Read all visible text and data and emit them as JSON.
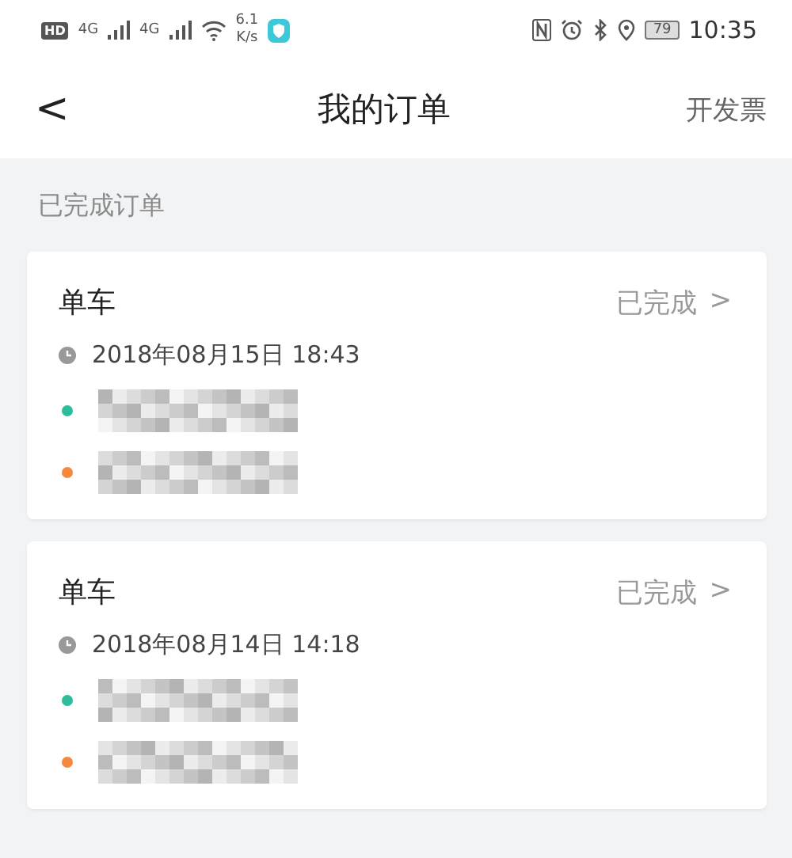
{
  "status_bar": {
    "hd": "HD",
    "networks": [
      "4G",
      "4G"
    ],
    "speed_value": "6.1",
    "speed_unit": "K/s",
    "battery": "79",
    "time": "10:35"
  },
  "header": {
    "back": "<",
    "title": "我的订单",
    "action": "开发票"
  },
  "section_title": "已完成订单",
  "orders": [
    {
      "type": "单车",
      "status": "已完成",
      "chevron": ">",
      "time": "2018年08月15日 18:43",
      "points": [
        {
          "color": "#2dbd9b"
        },
        {
          "color": "#f5883f"
        }
      ]
    },
    {
      "type": "单车",
      "status": "已完成",
      "chevron": ">",
      "time": "2018年08月14日 14:18",
      "points": [
        {
          "color": "#2dbd9b"
        },
        {
          "color": "#f5883f"
        }
      ]
    }
  ]
}
